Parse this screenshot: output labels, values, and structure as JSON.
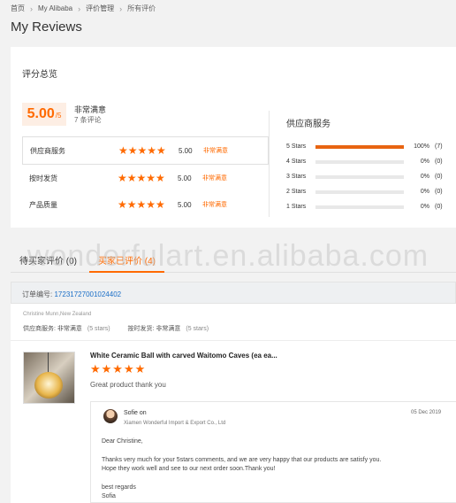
{
  "breadcrumb": [
    "首页",
    "My Alibaba",
    "评价管理",
    "所有评价"
  ],
  "page_title": "My Reviews",
  "summary": {
    "title": "评分总览",
    "score": "5.00",
    "score_suffix": "/5",
    "score_label": "非常满意",
    "review_count": "7 条评论",
    "rows": [
      {
        "label": "供应商服务",
        "stars": "★★★★★",
        "value": "5.00",
        "tag": "非常满意"
      },
      {
        "label": "按时发货",
        "stars": "★★★★★",
        "value": "5.00",
        "tag": "非常满意"
      },
      {
        "label": "产品质量",
        "stars": "★★★★★",
        "value": "5.00",
        "tag": "非常满意"
      }
    ],
    "supplier_title": "供应商服务",
    "distribution": [
      {
        "label": "5 Stars",
        "fraction": 1.0,
        "pct": "100%",
        "count": "(7)"
      },
      {
        "label": "4 Stars",
        "fraction": 0,
        "pct": "0%",
        "count": "(0)"
      },
      {
        "label": "3 Stars",
        "fraction": 0,
        "pct": "0%",
        "count": "(0)"
      },
      {
        "label": "2 Stars",
        "fraction": 0,
        "pct": "0%",
        "count": "(0)"
      },
      {
        "label": "1 Stars",
        "fraction": 0,
        "pct": "0%",
        "count": "(0)"
      }
    ]
  },
  "watermark": "wonderfulart.en.alibaba.com",
  "tabs": [
    {
      "label": "待买家评价 (0)"
    },
    {
      "label": "买家已评价 (4)"
    }
  ],
  "order": {
    "prefix": "订单编号:",
    "number": "17231727001024402"
  },
  "review": {
    "buyer_location": "Christine Munn,New Zealand",
    "supplier_service_label": "供应商服务:",
    "supplier_service_value": "非常满意",
    "supplier_service_stars": "(5 stars)",
    "delivery_label": "按时发货:",
    "delivery_value": "非常满意",
    "delivery_stars": "(5 stars)",
    "product_title": "White Ceramic Ball with carved Waitomo Caves (ea ea...",
    "stars": "★★★★★",
    "comment": "Great product thank you",
    "reply": {
      "name": "Sofie on",
      "company": "Xiamen Wonderful Import & Export Co., Ltd",
      "date": "05 Dec 2019",
      "greeting": "Dear Christine,",
      "line1": "Thanks very much for your 5stars comments, and we are very happy that our products are satisfy you.",
      "line2": "Hope they work well and see to our next order soon.Thank you!",
      "sign1": "best regards",
      "sign2": "Sofia"
    }
  },
  "colors": {
    "accent": "#ff6a00",
    "bar": "#e86411",
    "link": "#1a6ec7"
  }
}
